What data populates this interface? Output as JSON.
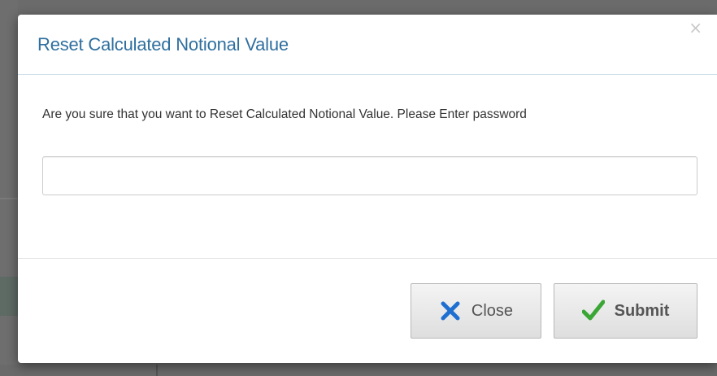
{
  "dialog": {
    "title": "Reset Calculated Notional Value",
    "close_icon_glyph": "×",
    "prompt": "Are you sure that you want to Reset Calculated Notional Value. Please Enter password",
    "password_field": {
      "value": "",
      "placeholder": ""
    },
    "buttons": {
      "close": {
        "label": "Close",
        "icon": "x-icon",
        "icon_color": "#1f6fd1"
      },
      "submit": {
        "label": "Submit",
        "icon": "check-icon",
        "icon_color": "#3aa635"
      }
    }
  },
  "colors": {
    "title": "#2f6f9f",
    "backdrop": "#6b6b6b",
    "modal_background": "#ffffff"
  }
}
